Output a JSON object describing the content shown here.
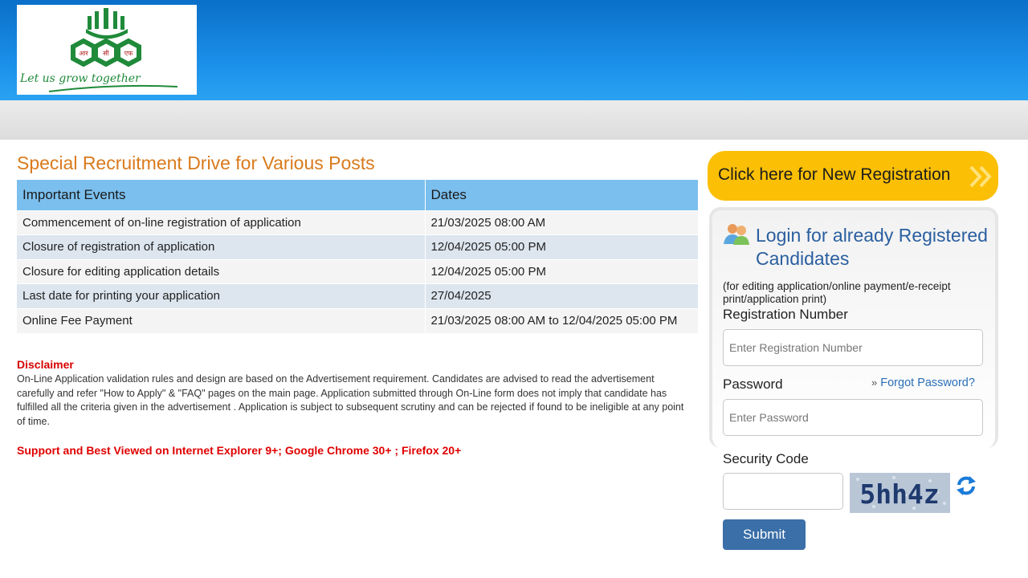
{
  "header": {
    "logo_text": "Let us grow together",
    "logo_emblem_text": "आर सी एफ"
  },
  "main": {
    "title": "Special Recruitment Drive for Various Posts",
    "table": {
      "headers": [
        "Important Events",
        "Dates"
      ],
      "rows": [
        {
          "event": "Commencement of on-line registration of application",
          "date": "21/03/2025 08:00 AM"
        },
        {
          "event": "Closure of registration of application",
          "date": "12/04/2025 05:00 PM"
        },
        {
          "event": "Closure for editing application details",
          "date": "12/04/2025 05:00 PM"
        },
        {
          "event": "Last date for printing your application",
          "date": "27/04/2025"
        },
        {
          "event": "Online Fee Payment",
          "date": "21/03/2025 08:00 AM to 12/04/2025 05:00 PM"
        }
      ]
    },
    "disclaimer_title": "Disclaimer",
    "disclaimer_text": "On-Line Application validation rules and design are based on the Advertisement requirement. Candidates are advised to read the advertisement carefully and refer \"How to Apply\" & \"FAQ\" pages on the main page. Application submitted through On-Line form does not imply that candidate has fulfilled all the criteria given in the advertisement . Application is subject to subsequent scrutiny and can be rejected if found to be ineligible at any point of time.",
    "support_text": "Support and Best Viewed on Internet Explorer 9+; Google Chrome 30+ ; Firefox 20+"
  },
  "sidebar": {
    "new_registration_label": "Click here for New Registration",
    "login_title": "Login for already Registered Candidates",
    "login_note": "(for editing application/online payment/e-receipt print/application print)",
    "registration_label": "Registration Number",
    "registration_placeholder": "Enter Registration Number",
    "password_label": "Password",
    "password_placeholder": "Enter Password",
    "forgot_password_label": "Forgot Password?",
    "security_code_label": "Security Code",
    "captcha_text": "5hh4z",
    "submit_label": "Submit"
  },
  "colors": {
    "header_blue": "#1a8ee8",
    "title_orange": "#d97a1c",
    "table_header": "#7bbfee",
    "register_button": "#fbbf05",
    "login_title_blue": "#2a5fa0",
    "submit_button": "#3a6fa8",
    "disclaimer_red": "#d60000"
  },
  "icons": {
    "users": "users-icon",
    "chevron": "double-chevron-right-icon",
    "forgot": "double-chevron-right-icon",
    "refresh": "refresh-icon"
  }
}
